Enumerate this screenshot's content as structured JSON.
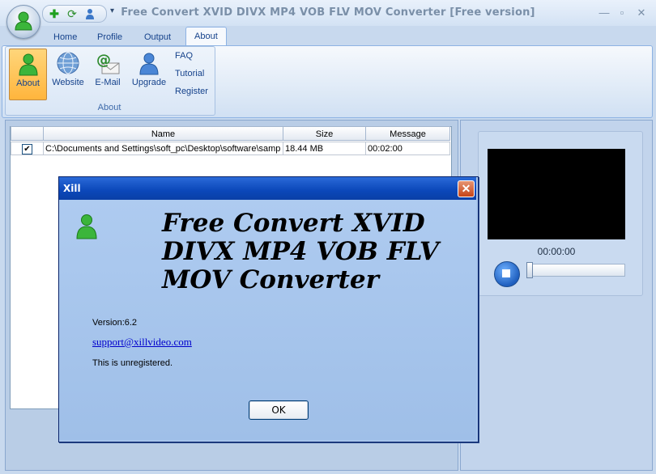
{
  "window": {
    "title": "Free Convert XVID DIVX MP4 VOB FLV MOV Converter  [Free version]",
    "controls": {
      "minimize": "—",
      "maximize": "▫",
      "close": "✕"
    }
  },
  "quick_access": {
    "more": "▾"
  },
  "tabs": [
    {
      "label": "Home"
    },
    {
      "label": "Profile"
    },
    {
      "label": "Output"
    },
    {
      "label": "About",
      "active": true
    }
  ],
  "ribbon": {
    "group_label": "About",
    "buttons": [
      {
        "label": "About",
        "icon": "user-green-icon",
        "pressed": true
      },
      {
        "label": "Website",
        "icon": "globe-icon"
      },
      {
        "label": "E-Mail",
        "icon": "email-icon"
      },
      {
        "label": "Upgrade",
        "icon": "user-blue-icon"
      }
    ],
    "links": [
      "FAQ",
      "Tutorial",
      "Register"
    ]
  },
  "file_list": {
    "columns": [
      "Name",
      "Size",
      "Message"
    ],
    "rows": [
      {
        "checked": "✔",
        "name": "C:\\Documents and Settings\\soft_pc\\Desktop\\software\\samp",
        "size": "18.44 MB",
        "message": "00:02:00"
      }
    ]
  },
  "preview": {
    "timecode": "00:00:00",
    "seek_position": 0
  },
  "dialog": {
    "title": "Xill",
    "close": "✕",
    "heading": "Free Convert XVID DIVX MP4 VOB FLV MOV Converter",
    "version": "Version:6.2",
    "email": "support@xillvideo.com",
    "registration": "This is unregistered.",
    "ok_label": "OK"
  },
  "colors": {
    "ribbon_text": "#15428b",
    "dialog_title": "#0b47b9",
    "pressed_button": "#ffb53d"
  }
}
